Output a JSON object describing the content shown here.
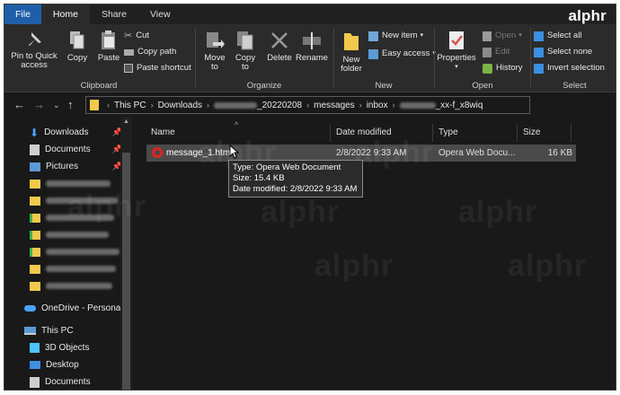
{
  "tabs": [
    "File",
    "Home",
    "Share",
    "View"
  ],
  "brand": "alphr",
  "ribbon": {
    "clipboard": {
      "pin": "Pin to Quick access",
      "copy": "Copy",
      "paste": "Paste",
      "cut": "Cut",
      "copy_path": "Copy path",
      "paste_shortcut": "Paste shortcut",
      "label": "Clipboard"
    },
    "organize": {
      "move_to": "Move to",
      "copy_to": "Copy to",
      "delete": "Delete",
      "rename": "Rename",
      "label": "Organize"
    },
    "new": {
      "new_folder": "New folder",
      "new_item": "New item",
      "easy_access": "Easy access",
      "label": "New"
    },
    "open": {
      "properties": "Properties",
      "open": "Open",
      "edit": "Edit",
      "history": "History",
      "label": "Open"
    },
    "select": {
      "select_all": "Select all",
      "select_none": "Select none",
      "invert": "Invert selection",
      "label": "Select"
    }
  },
  "address": {
    "crumbs": [
      "This PC",
      "Downloads",
      "_20220208",
      "messages",
      "inbox",
      "_xx-f_x8wiq"
    ]
  },
  "nav": {
    "quick": [
      {
        "label": "Downloads",
        "icon": "download-arrow-icon"
      },
      {
        "label": "Documents",
        "icon": "documents-icon"
      },
      {
        "label": "Pictures",
        "icon": "pictures-icon"
      }
    ],
    "onedrive": "OneDrive - Personal",
    "thispc": "This PC",
    "pc_items": [
      "3D Objects",
      "Desktop",
      "Documents"
    ]
  },
  "columns": {
    "name": "Name",
    "date": "Date modified",
    "type": "Type",
    "size": "Size"
  },
  "file": {
    "name": "message_1.html",
    "date": "2/8/2022 9:33 AM",
    "type": "Opera Web Docu...",
    "size": "16 KB"
  },
  "tooltip": {
    "type": "Type: Opera Web Document",
    "size": "Size: 15.4 KB",
    "date": "Date modified: 2/8/2022 9:33 AM"
  },
  "colors": {
    "file_tab": "#1f5fa8",
    "folder": "#f2c94c",
    "selection": "#4a4a4a",
    "opera": "#e0221f"
  }
}
